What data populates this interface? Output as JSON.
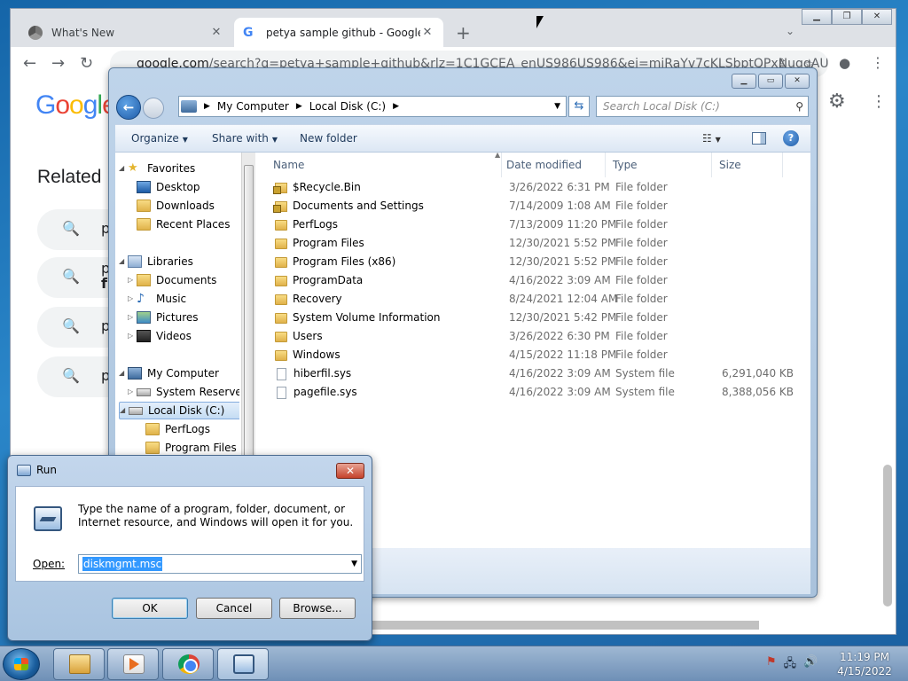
{
  "chrome": {
    "tabs": [
      {
        "title": "What's New",
        "close": "✕"
      },
      {
        "title": "petya sample github - Google Se",
        "close": "✕"
      }
    ],
    "url_host": "google.com",
    "url_rest": "/search?q=petya+sample+github&rlz=1C1GCEA_enUS986US986&ei=miRaYv7cKLSbptQPxNuqqAU&...",
    "related_heading": "Related",
    "related_items": [
      "p",
      "p",
      "p",
      "p"
    ],
    "related_item_bold": "f"
  },
  "explorer": {
    "address": {
      "crumbs": [
        "My Computer",
        "Local Disk (C:)"
      ]
    },
    "search_placeholder": "Search Local Disk (C:)",
    "commands": {
      "organize": "Organize",
      "share": "Share with",
      "new_folder": "New folder"
    },
    "nav": {
      "favorites": "Favorites",
      "favorites_items": [
        "Desktop",
        "Downloads",
        "Recent Places"
      ],
      "libraries": "Libraries",
      "libraries_items": [
        "Documents",
        "Music",
        "Pictures",
        "Videos"
      ],
      "computer": "My Computer",
      "computer_items": [
        "System Reserved",
        "Local Disk (C:)"
      ],
      "disk_items": [
        "PerfLogs",
        "Program Files"
      ]
    },
    "columns": {
      "name": "Name",
      "date": "Date modified",
      "type": "Type",
      "size": "Size"
    },
    "files": [
      {
        "name": "$Recycle.Bin",
        "date": "3/26/2022 6:31 PM",
        "type": "File folder",
        "size": "",
        "icon": "locked-folder-icon"
      },
      {
        "name": "Documents and Settings",
        "date": "7/14/2009 1:08 AM",
        "type": "File folder",
        "size": "",
        "icon": "locked-folder-icon"
      },
      {
        "name": "PerfLogs",
        "date": "7/13/2009 11:20 PM",
        "type": "File folder",
        "size": "",
        "icon": "folder-icon"
      },
      {
        "name": "Program Files",
        "date": "12/30/2021 5:52 PM",
        "type": "File folder",
        "size": "",
        "icon": "folder-icon"
      },
      {
        "name": "Program Files (x86)",
        "date": "12/30/2021 5:52 PM",
        "type": "File folder",
        "size": "",
        "icon": "folder-icon"
      },
      {
        "name": "ProgramData",
        "date": "4/16/2022 3:09 AM",
        "type": "File folder",
        "size": "",
        "icon": "folder-icon"
      },
      {
        "name": "Recovery",
        "date": "8/24/2021 12:04 AM",
        "type": "File folder",
        "size": "",
        "icon": "folder-icon"
      },
      {
        "name": "System Volume Information",
        "date": "12/30/2021 5:42 PM",
        "type": "File folder",
        "size": "",
        "icon": "folder-icon"
      },
      {
        "name": "Users",
        "date": "3/26/2022 6:30 PM",
        "type": "File folder",
        "size": "",
        "icon": "folder-icon"
      },
      {
        "name": "Windows",
        "date": "4/15/2022 11:18 PM",
        "type": "File folder",
        "size": "",
        "icon": "folder-icon"
      },
      {
        "name": "hiberfil.sys",
        "date": "4/16/2022 3:09 AM",
        "type": "System file",
        "size": "6,291,040 KB",
        "icon": "system-file-icon"
      },
      {
        "name": "pagefile.sys",
        "date": "4/16/2022 3:09 AM",
        "type": "System file",
        "size": "8,388,056 KB",
        "icon": "system-file-icon"
      }
    ]
  },
  "run": {
    "title": "Run",
    "close": "✕",
    "description": "Type the name of a program, folder, document, or Internet resource, and Windows will open it for you.",
    "open_label": "Open:",
    "open_value": "diskmgmt.msc",
    "ok": "OK",
    "cancel": "Cancel",
    "browse": "Browse..."
  },
  "taskbar": {
    "time": "11:19 PM",
    "date": "4/15/2022"
  }
}
